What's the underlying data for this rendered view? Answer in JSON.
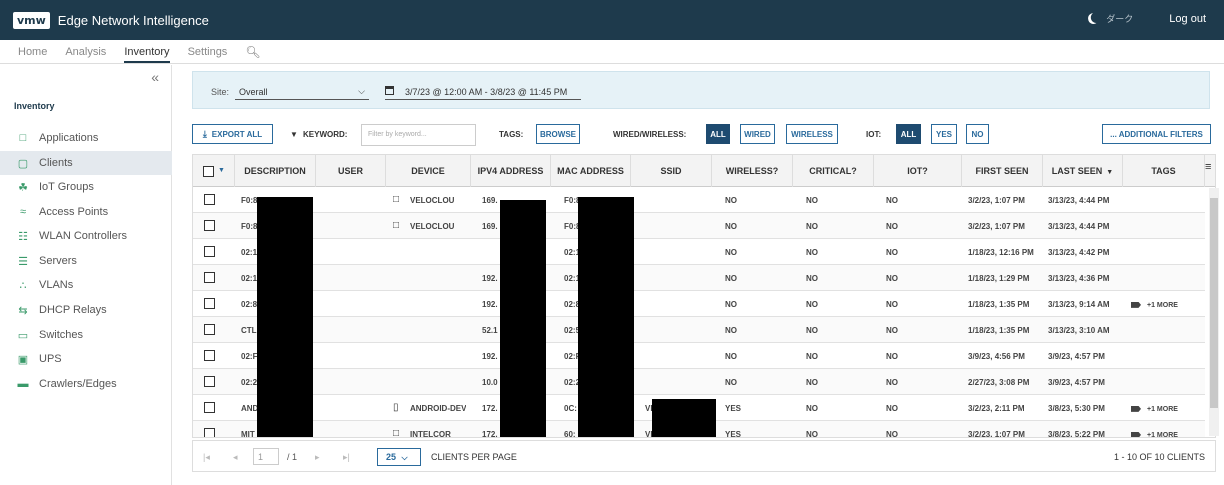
{
  "app": {
    "logo": "vmw",
    "title": "Edge Network Intelligence",
    "dark_label": "ダーク",
    "logout": "Log out"
  },
  "nav": {
    "tabs": [
      "Home",
      "Analysis",
      "Inventory",
      "Settings"
    ],
    "active": "Inventory"
  },
  "sidebar": {
    "heading": "Inventory",
    "items": [
      {
        "label": "Applications",
        "icon": "applications-icon"
      },
      {
        "label": "Clients",
        "icon": "clients-icon",
        "active": true
      },
      {
        "label": "IoT Groups",
        "icon": "iot-groups-icon"
      },
      {
        "label": "Access Points",
        "icon": "wifi-icon"
      },
      {
        "label": "WLAN Controllers",
        "icon": "wlan-controller-icon"
      },
      {
        "label": "Servers",
        "icon": "server-icon"
      },
      {
        "label": "VLANs",
        "icon": "vlan-icon"
      },
      {
        "label": "DHCP Relays",
        "icon": "dhcp-relay-icon"
      },
      {
        "label": "Switches",
        "icon": "switch-icon"
      },
      {
        "label": "UPS",
        "icon": "ups-icon"
      },
      {
        "label": "Crawlers/Edges",
        "icon": "crawler-icon"
      }
    ]
  },
  "filters": {
    "site_label": "Site:",
    "site_value": "Overall",
    "date_range": "3/7/23 @ 12:00 AM - 3/8/23 @ 11:45 PM"
  },
  "toolbar": {
    "export": "EXPORT ALL",
    "keyword_label": "KEYWORD:",
    "keyword_placeholder": "Filter by keyword...",
    "tags_label": "TAGS:",
    "browse": "BROWSE",
    "wired_label": "WIRED/WIRELESS:",
    "wired_options": [
      "ALL",
      "WIRED",
      "WIRELESS"
    ],
    "iot_label": "IOT:",
    "iot_options": [
      "ALL",
      "YES",
      "NO"
    ],
    "additional": "... ADDITIONAL FILTERS"
  },
  "table": {
    "columns": [
      "DESCRIPTION",
      "USER",
      "DEVICE",
      "IPV4 ADDRESS",
      "MAC ADDRESS",
      "SSID",
      "WIRELESS?",
      "CRITICAL?",
      "IOT?",
      "FIRST SEEN",
      "LAST SEEN",
      "TAGS"
    ],
    "rows": [
      {
        "description": "F0:8",
        "user": "",
        "device": "VELOCLOU",
        "device_icon": "monitor-icon",
        "ipv4": "169.",
        "mac": "F0:8",
        "ssid": "",
        "wireless": "NO",
        "critical": "NO",
        "iot": "NO",
        "first_seen": "3/2/23, 1:07 PM",
        "last_seen": "3/13/23, 4:44 PM",
        "tags": ""
      },
      {
        "description": "F0:8",
        "user": "",
        "device": "VELOCLOU",
        "device_icon": "monitor-icon",
        "ipv4": "169.",
        "mac": "F0:8",
        "ssid": "",
        "wireless": "NO",
        "critical": "NO",
        "iot": "NO",
        "first_seen": "3/2/23, 1:07 PM",
        "last_seen": "3/13/23, 4:44 PM",
        "tags": ""
      },
      {
        "description": "02:1",
        "user": "",
        "device": "",
        "ipv4": "",
        "mac": "02:1",
        "ssid": "",
        "wireless": "NO",
        "critical": "NO",
        "iot": "NO",
        "first_seen": "1/18/23, 12:16 PM",
        "last_seen": "3/13/23, 4:42 PM",
        "tags": ""
      },
      {
        "description": "02:1",
        "user": "",
        "device": "",
        "ipv4": "192.",
        "mac": "02:1",
        "ssid": "",
        "wireless": "NO",
        "critical": "NO",
        "iot": "NO",
        "first_seen": "1/18/23, 1:29 PM",
        "last_seen": "3/13/23, 4:36 PM",
        "tags": ""
      },
      {
        "description": "02:8",
        "user": "",
        "device": "",
        "ipv4": "192.",
        "mac": "02:8",
        "ssid": "",
        "wireless": "NO",
        "critical": "NO",
        "iot": "NO",
        "first_seen": "1/18/23, 1:35 PM",
        "last_seen": "3/13/23, 9:14 AM",
        "tags": "+1 MORE"
      },
      {
        "description": "CTL",
        "user": "",
        "device": "",
        "ipv4": "52.1",
        "mac": "02:5",
        "ssid": "",
        "wireless": "NO",
        "critical": "NO",
        "iot": "NO",
        "first_seen": "1/18/23, 1:35 PM",
        "last_seen": "3/13/23, 3:10 AM",
        "tags": ""
      },
      {
        "description": "02:F",
        "user": "",
        "device": "",
        "ipv4": "192.",
        "mac": "02:F",
        "ssid": "",
        "wireless": "NO",
        "critical": "NO",
        "iot": "NO",
        "first_seen": "3/9/23, 4:56 PM",
        "last_seen": "3/9/23, 4:57 PM",
        "tags": ""
      },
      {
        "description": "02:2",
        "user": "",
        "device": "",
        "ipv4": "10.0",
        "mac": "02:2",
        "ssid": "",
        "wireless": "NO",
        "critical": "NO",
        "iot": "NO",
        "first_seen": "2/27/23, 3:08 PM",
        "last_seen": "3/9/23, 4:57 PM",
        "tags": ""
      },
      {
        "description": "AND",
        "user": "",
        "device": "ANDROID-DEV",
        "device_icon": "phone-icon",
        "ipv4": "172.",
        "mac": "0C:",
        "ssid": "VI",
        "wireless": "YES",
        "critical": "NO",
        "iot": "NO",
        "first_seen": "3/2/23, 2:11 PM",
        "last_seen": "3/8/23, 5:30 PM",
        "tags": "+1 MORE"
      },
      {
        "description": "MIT",
        "user": "",
        "device": "INTELCOR",
        "device_icon": "monitor-icon",
        "ipv4": "172.",
        "mac": "60:",
        "ssid": "VI",
        "wireless": "YES",
        "critical": "NO",
        "iot": "NO",
        "first_seen": "3/2/23, 1:07 PM",
        "last_seen": "3/8/23, 5:22 PM",
        "tags": "+1 MORE"
      }
    ]
  },
  "pager": {
    "page": "1",
    "of": "/ 1",
    "per_page": "25",
    "per_page_label": "CLIENTS PER PAGE",
    "summary": "1 - 10 OF 10 CLIENTS"
  }
}
